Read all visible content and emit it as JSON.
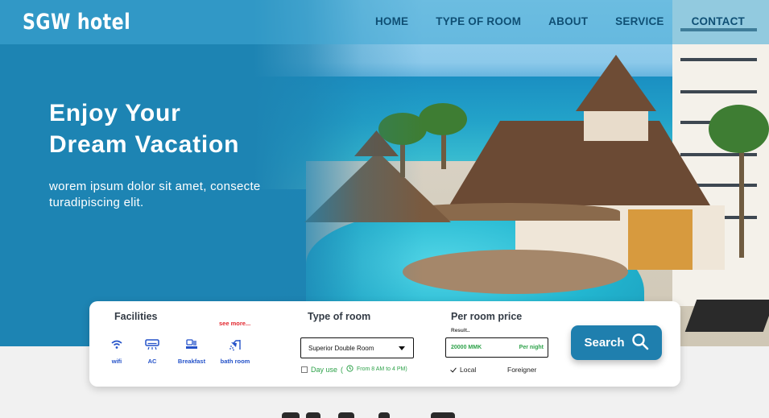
{
  "header": {
    "brand": "SGW  hotel",
    "nav": [
      "HOME",
      "TYPE OF ROOM",
      "ABOUT",
      "SERVICE",
      "CONTACT"
    ]
  },
  "hero": {
    "title_line1": "Enjoy Your",
    "title_line2": "Dream Vacation",
    "subtitle": "worem ipsum dolor sit amet, consecte turadipiscing elit."
  },
  "booking": {
    "facilities": {
      "title": "Facilities",
      "see_more": "see more...",
      "items": [
        {
          "label": "wifi",
          "icon": "wifi-icon"
        },
        {
          "label": "AC",
          "icon": "ac-icon"
        },
        {
          "label": "Breakfast",
          "icon": "breakfast-icon"
        },
        {
          "label": "bath room",
          "icon": "shower-icon"
        }
      ]
    },
    "room": {
      "title": "Type of room",
      "selected": "Superior Double Room",
      "day_use_label": "Day use",
      "day_use_hours": "From 8 AM to 4 PM)",
      "day_use_open_paren": "(",
      "day_use_checked": false
    },
    "price": {
      "title": "Per room price",
      "result_label": "Result..",
      "amount": "20000 MMK",
      "unit": "Per night",
      "local_label": "Local",
      "local_checked": true,
      "foreigner_label": "Foreigner"
    },
    "search_label": "Search"
  },
  "colors": {
    "primary": "#1f7fae",
    "nav_text": "#0f4f74",
    "facility_blue": "#2452c9",
    "accent_green": "#2ea24a",
    "see_more_red": "#e2262d"
  }
}
